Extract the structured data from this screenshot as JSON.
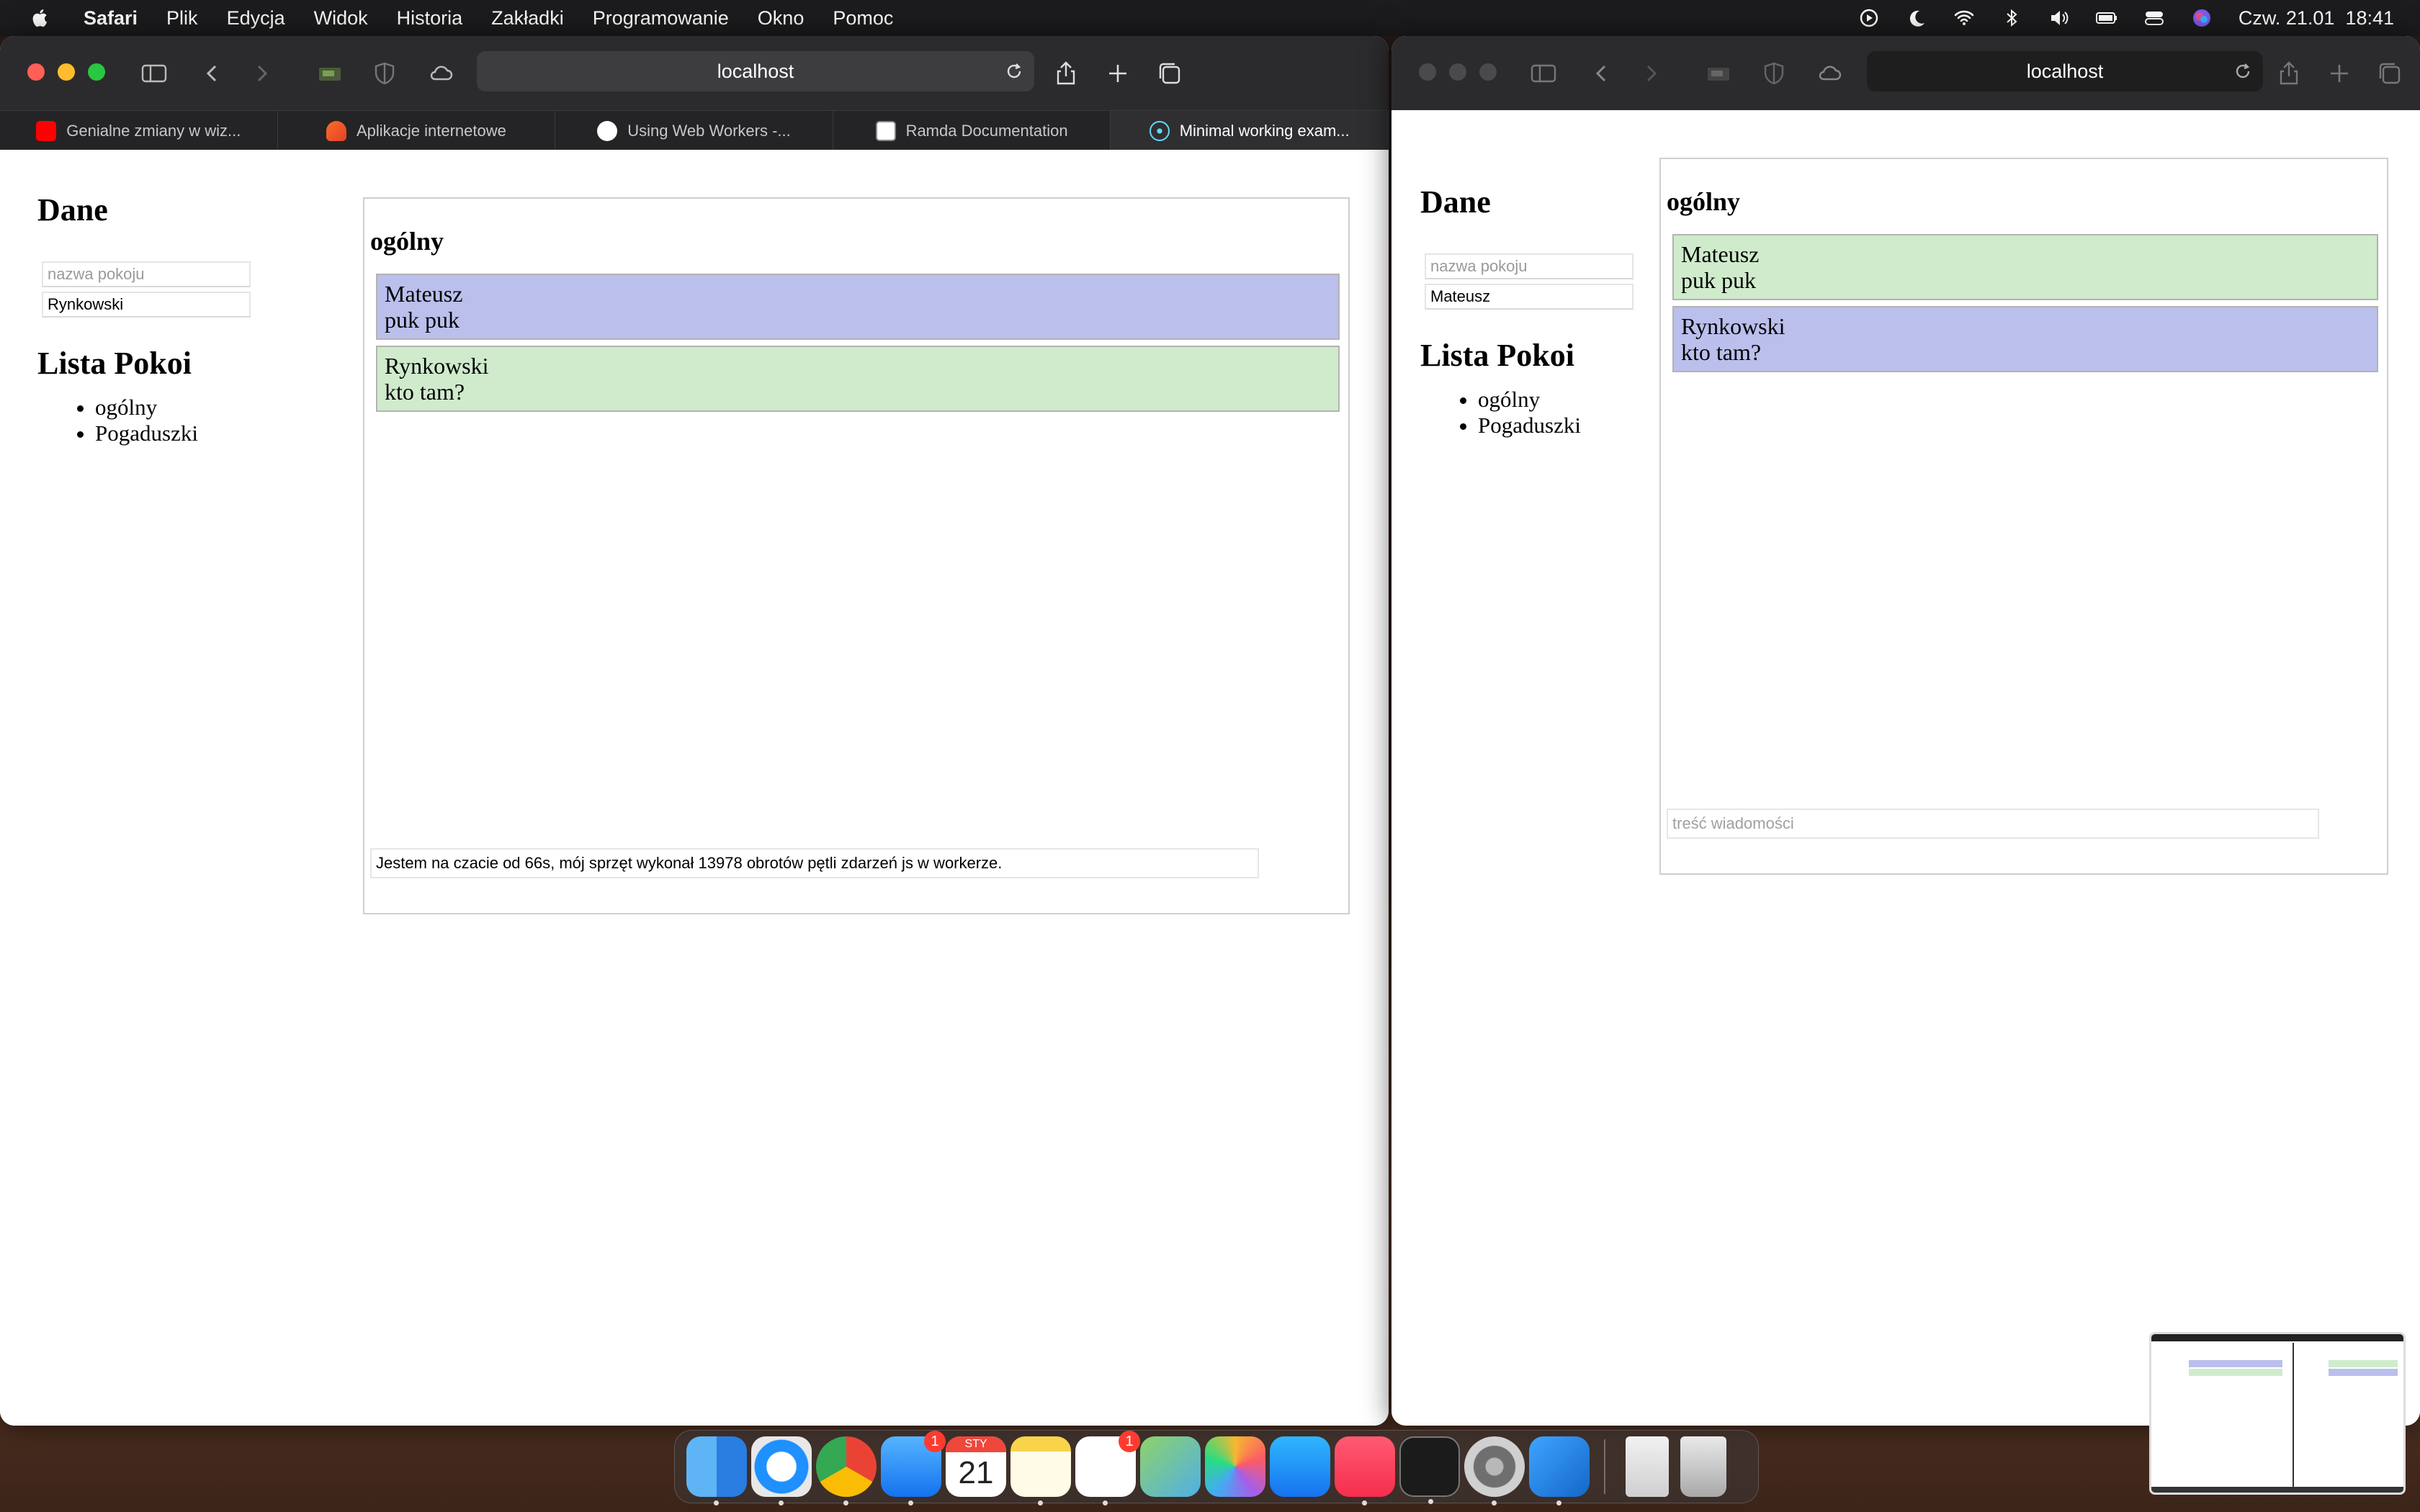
{
  "menubar": {
    "app": "Safari",
    "items": [
      "Plik",
      "Edycja",
      "Widok",
      "Historia",
      "Zakładki",
      "Programowanie",
      "Okno",
      "Pomoc"
    ],
    "datetime": "Czw. 21.01  18:41"
  },
  "window1": {
    "url": "localhost",
    "tabs": [
      {
        "label": "Genialne zmiany w wiz...",
        "icon": "youtube-icon"
      },
      {
        "label": "Aplikacje internetowe",
        "icon": "gitlab-icon"
      },
      {
        "label": "Using Web Workers -...",
        "icon": "mdn-icon"
      },
      {
        "label": "Ramda Documentation",
        "icon": "ramda-icon"
      },
      {
        "label": "Minimal working exam...",
        "icon": "react-icon"
      }
    ],
    "page": {
      "heading": "Dane",
      "room_placeholder": "nazwa pokoju",
      "username": "Rynkowski",
      "rooms_heading": "Lista Pokoi",
      "rooms": [
        "ogólny",
        "Pogaduszki"
      ],
      "current_room": "ogólny",
      "messages": [
        {
          "author": "Mateusz",
          "text": "puk puk"
        },
        {
          "author": "Rynkowski",
          "text": "kto tam?"
        }
      ],
      "status": "Jestem na czacie od 66s, mój sprzęt wykonał 13978 obrotów pętli zdarzeń js w workerze."
    }
  },
  "window2": {
    "url": "localhost",
    "page": {
      "heading": "Dane",
      "room_placeholder": "nazwa pokoju",
      "username": "Mateusz",
      "rooms_heading": "Lista Pokoi",
      "rooms": [
        "ogólny",
        "Pogaduszki"
      ],
      "current_room": "ogólny",
      "messages": [
        {
          "author": "Mateusz",
          "text": "puk puk"
        },
        {
          "author": "Rynkowski",
          "text": "kto tam?"
        }
      ],
      "message_placeholder": "treść wiadomości"
    }
  },
  "dock": {
    "apps": [
      "finder",
      "safari",
      "chrome",
      "mail",
      "calendar",
      "notes",
      "reminders",
      "maps",
      "photos",
      "app-store",
      "music",
      "terminal",
      "system-preferences",
      "vscode",
      "documents",
      "trash"
    ],
    "mail_badge": "1",
    "reminders_badge": "1",
    "calendar_month": "STY",
    "calendar_day": "21"
  },
  "colors": {
    "own_message": "#bbbfec",
    "other_message": "#cfebcc"
  }
}
